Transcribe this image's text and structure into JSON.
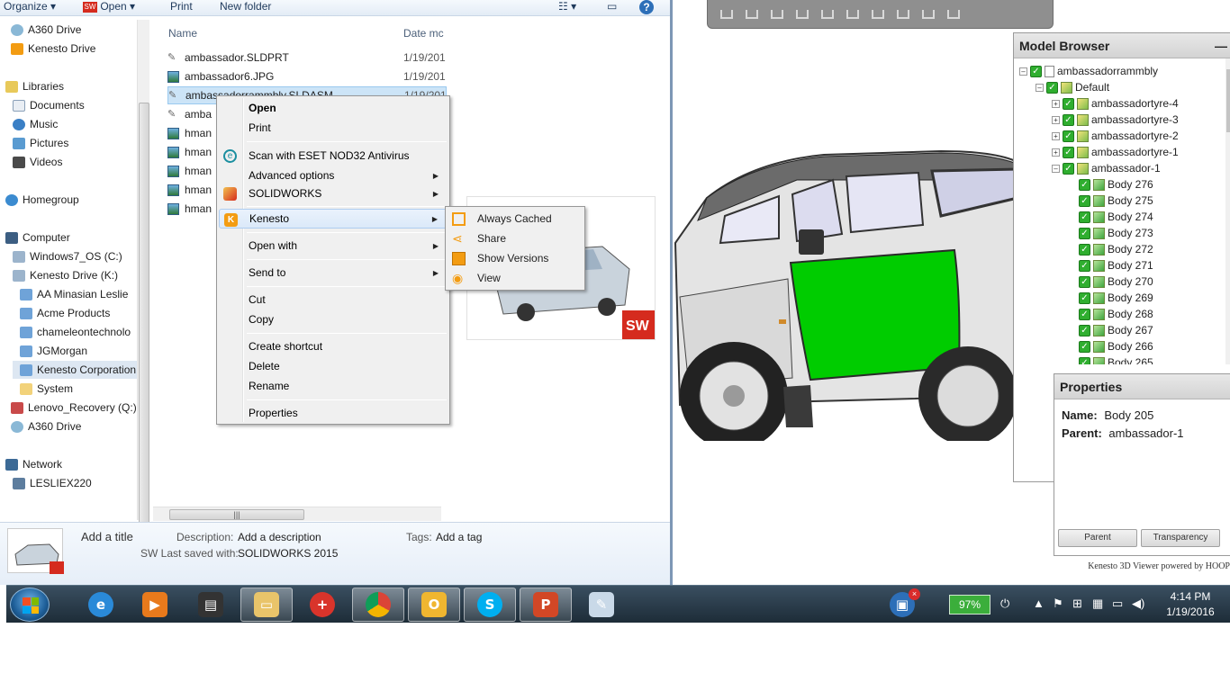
{
  "explorer": {
    "toolbar": {
      "organize": "Organize",
      "open": "Open",
      "print": "Print",
      "new_folder": "New folder"
    },
    "nav": {
      "items": [
        "A360 Drive",
        "Kenesto Drive",
        "Libraries",
        "Documents",
        "Music",
        "Pictures",
        "Videos",
        "Homegroup",
        "Computer",
        "Windows7_OS (C:)",
        "Kenesto Drive (K:)",
        "AA Minasian Leslie",
        "Acme Products",
        "chameleontechnolo",
        "JGMorgan",
        "Kenesto Corporation",
        "System",
        "Lenovo_Recovery (Q:)",
        "A360 Drive",
        "Network",
        "LESLIEX220"
      ]
    },
    "columns": {
      "name": "Name",
      "date": "Date mc"
    },
    "files": [
      {
        "name": "ambassador.SLDPRT",
        "date": "1/19/201"
      },
      {
        "name": "ambassador6.JPG",
        "date": "1/19/201"
      },
      {
        "name": "ambassadorrammbly.SLDASM",
        "date": "1/19/201"
      },
      {
        "name": "amba",
        "date": ""
      },
      {
        "name": "hman",
        "date": ""
      },
      {
        "name": "hman",
        "date": ""
      },
      {
        "name": "hman",
        "date": ""
      },
      {
        "name": "hman",
        "date": ""
      },
      {
        "name": "hman",
        "date": ""
      }
    ],
    "details": {
      "title_prompt": "Add a title",
      "description_label": "Description:",
      "description_value": "Add a description",
      "tags_label": "Tags:",
      "tags_value": "Add a tag",
      "saved_label": "SW Last saved with:",
      "saved_value": "SOLIDWORKS 2015"
    }
  },
  "context_menu": {
    "items": [
      "Open",
      "Print",
      "Scan with ESET NOD32 Antivirus",
      "Advanced options",
      "SOLIDWORKS",
      "Kenesto",
      "Open with",
      "Send to",
      "Cut",
      "Copy",
      "Create shortcut",
      "Delete",
      "Rename",
      "Properties"
    ]
  },
  "submenu": {
    "items": [
      "Always Cached",
      "Share",
      "Show Versions",
      "View"
    ]
  },
  "viewer": {
    "model_browser": {
      "title": "Model Browser",
      "collapse": "—",
      "root": "ambassadorrammbly",
      "config": "Default",
      "tyres": [
        "ambassadortyre-4",
        "ambassadortyre-3",
        "ambassadortyre-2",
        "ambassadortyre-1"
      ],
      "part": "ambassador-1",
      "bodies": [
        "Body 276",
        "Body 275",
        "Body 274",
        "Body 273",
        "Body 272",
        "Body 271",
        "Body 270",
        "Body 269",
        "Body 268",
        "Body 267",
        "Body 266",
        "Body 265"
      ]
    },
    "properties": {
      "title": "Properties",
      "name_label": "Name:",
      "name_value": "Body 205",
      "parent_label": "Parent:",
      "parent_value": "ambassador-1",
      "buttons": [
        "Parent",
        "Transparency"
      ]
    },
    "powered_by": "Kenesto 3D Viewer powered by HOOP"
  },
  "taskbar": {
    "battery": "97%",
    "time": "4:14 PM",
    "date": "1/19/2016"
  },
  "colors": {
    "selection_green": "#00cc00",
    "taskbar": "#1d2c38",
    "kenesto_orange": "#f39c12",
    "solidworks_red": "#d52b1e"
  }
}
